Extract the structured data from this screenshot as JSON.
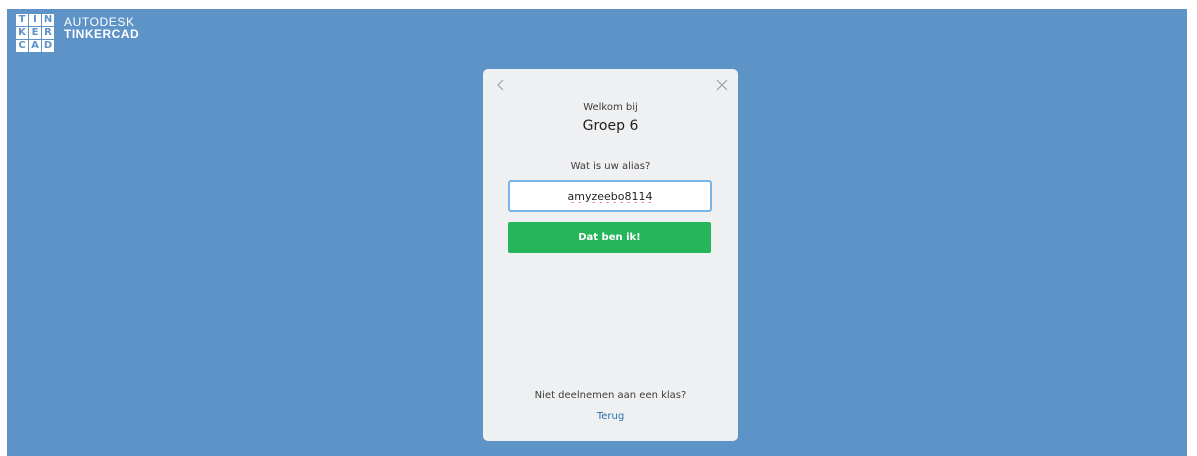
{
  "brand": {
    "logo_letters": [
      "T",
      "I",
      "N",
      "K",
      "E",
      "R",
      "C",
      "A",
      "D"
    ],
    "company": "AUTODESK",
    "product": "TINKERCAD"
  },
  "dialog": {
    "back_icon": "chevron-left-icon",
    "close_icon": "close-icon",
    "welcome": "Welkom bij",
    "class_name": "Groep 6",
    "alias_prompt": "Wat is uw alias?",
    "alias_value": "amyzeebo8114",
    "submit_label": "Dat ben ik!",
    "not_joining_text": "Niet deelnemen aan een klas?",
    "back_link": "Terug"
  },
  "colors": {
    "background": "#5d93c7",
    "card": "#eff0f2",
    "primary_button": "#27b55b",
    "input_focus_border": "#7db4e8",
    "link": "#2a6fb0"
  }
}
